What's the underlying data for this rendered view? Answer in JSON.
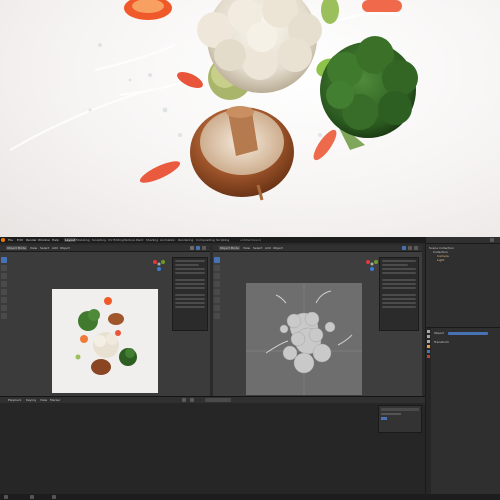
{
  "app": {
    "title": "untitled.blend",
    "menu": [
      "File",
      "Edit",
      "Render",
      "Window",
      "Help"
    ],
    "workspace_tabs": [
      "Layout",
      "Modeling",
      "Sculpting",
      "UV Editing",
      "Texture Paint",
      "Shading",
      "Animation",
      "Rendering",
      "Compositing",
      "Scripting"
    ],
    "active_tab": "Layout"
  },
  "left_viewport": {
    "header_items": [
      "Object Mode",
      "View",
      "Select",
      "Add",
      "Object"
    ],
    "mode": "Object Mode",
    "shading": "rendered"
  },
  "right_viewport": {
    "header_items": [
      "Object Mode",
      "View",
      "Select",
      "Add",
      "Object"
    ],
    "mode": "Object Mode",
    "shading": "solid"
  },
  "outliner": {
    "title": "Scene Collection",
    "items": [
      "Collection",
      "Camera",
      "Light"
    ]
  },
  "properties": {
    "items": [
      "Object",
      "Transform"
    ]
  },
  "timeline": {
    "header_items": [
      "Playback",
      "Keying",
      "View",
      "Marker"
    ]
  },
  "colors": {
    "accent": "#4772b3",
    "panel_bg": "#2a2a2a",
    "viewport_bg": "#3d3d3d"
  }
}
